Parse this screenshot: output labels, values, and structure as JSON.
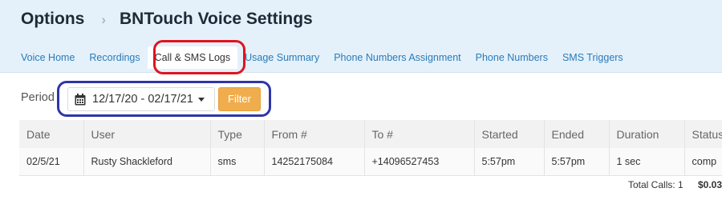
{
  "header": {
    "root": "Options",
    "separator": "›",
    "page_title": "BNTouch Voice Settings"
  },
  "tabs": [
    {
      "label": "Voice Home",
      "active": false
    },
    {
      "label": "Recordings",
      "active": false
    },
    {
      "label": "Call & SMS Logs",
      "active": true
    },
    {
      "label": "Usage Summary",
      "active": false
    },
    {
      "label": "Phone Numbers Assignment",
      "active": false
    },
    {
      "label": "Phone Numbers",
      "active": false
    },
    {
      "label": "SMS Triggers",
      "active": false
    }
  ],
  "filter": {
    "period_label": "Period",
    "date_range": "12/17/20 - 02/17/21",
    "button_label": "Filter"
  },
  "table": {
    "columns": [
      "Date",
      "User",
      "Type",
      "From #",
      "To #",
      "Started",
      "Ended",
      "Duration",
      "Status"
    ],
    "rows": [
      [
        "02/5/21",
        "Rusty Shackleford",
        "sms",
        "14252175084",
        "+14096527453",
        "5:57pm",
        "5:57pm",
        "1 sec",
        "comp"
      ]
    ],
    "total_label": "Total Calls: 1",
    "total_cost": "$0.03"
  },
  "colors": {
    "header_bg": "#e4f1fb",
    "link": "#2b7ab7",
    "filter_button": "#f0ad4e",
    "highlight_red": "#e0141e",
    "highlight_blue": "#2e35a8"
  },
  "icons": {
    "calendar": "calendar-icon",
    "caret": "caret-down-icon",
    "separator": "chevron-right-icon"
  }
}
